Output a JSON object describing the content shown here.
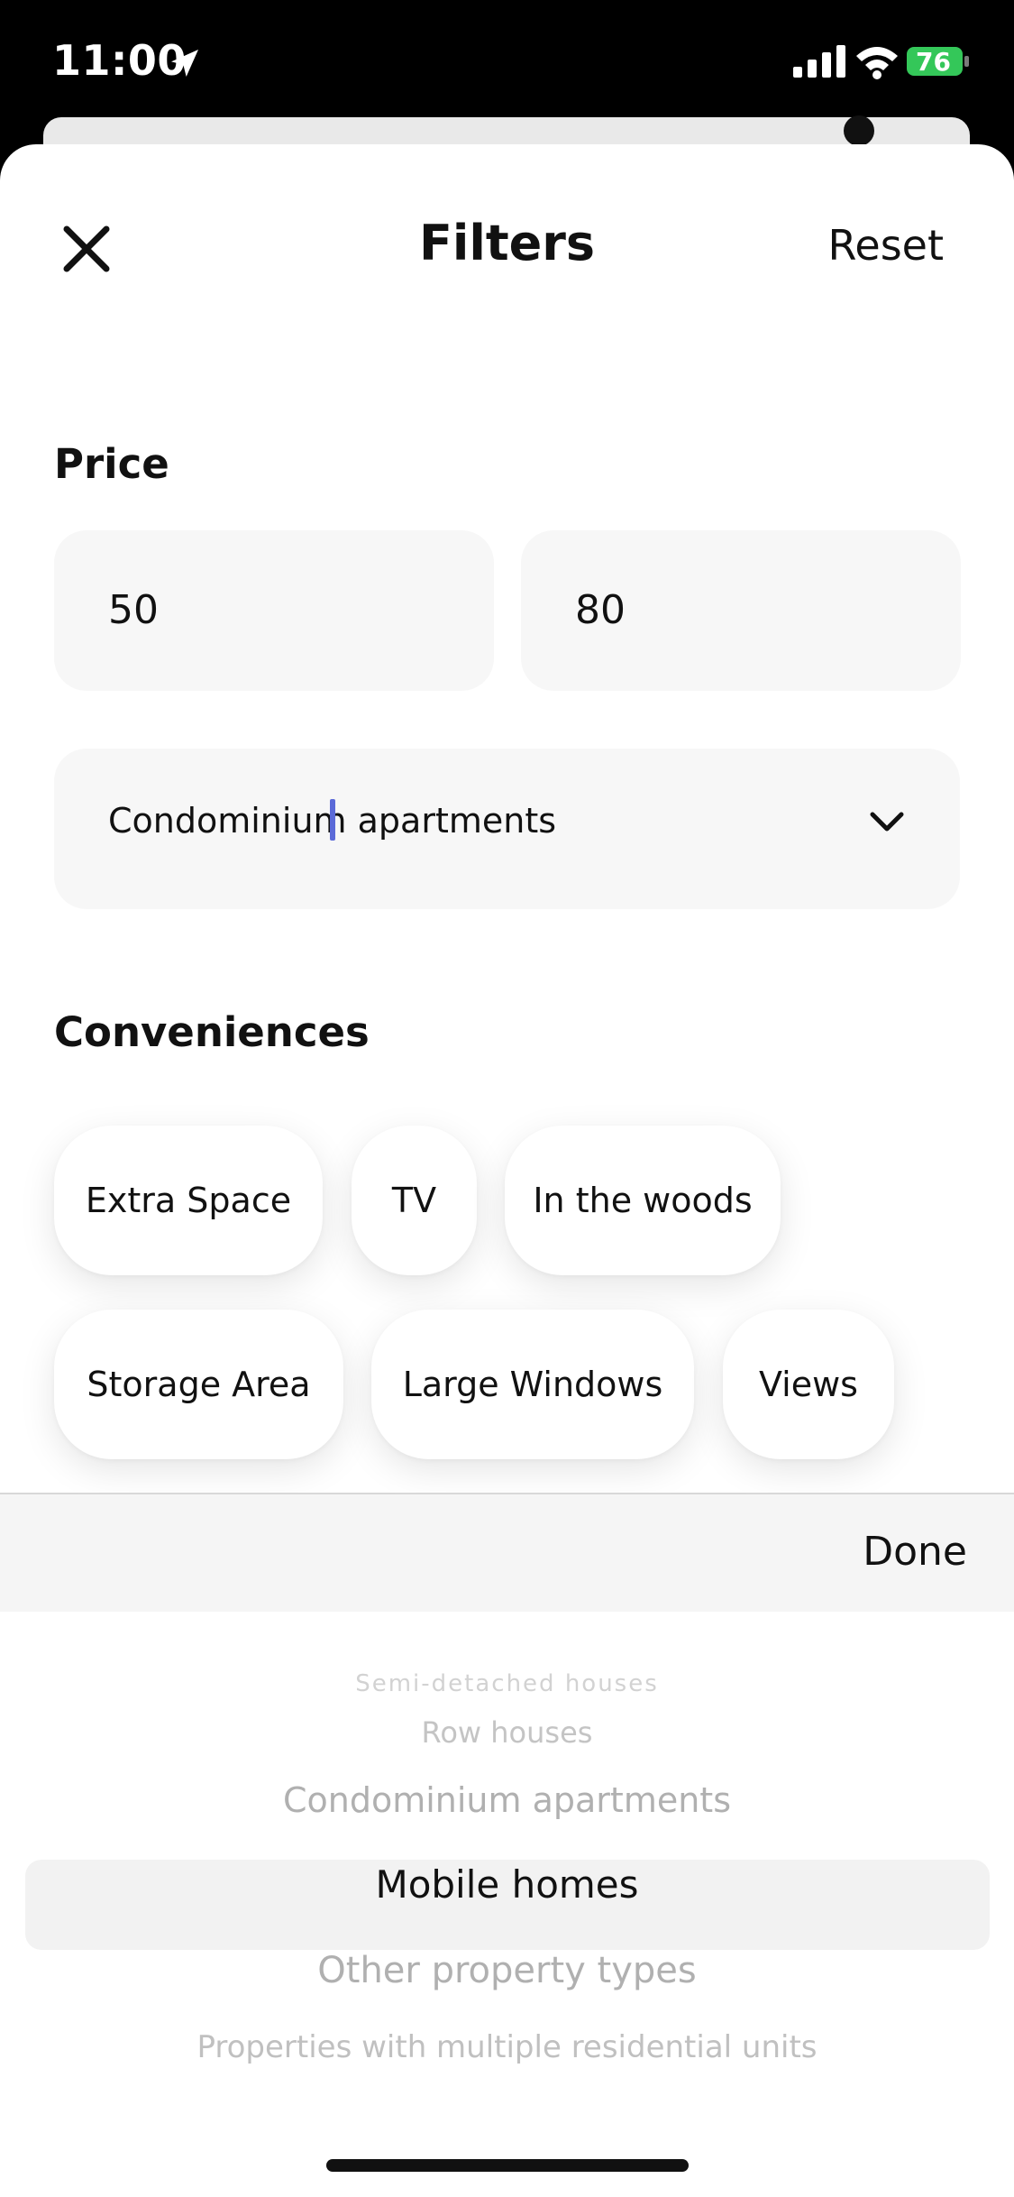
{
  "status_bar": {
    "time": "11:00",
    "battery": "76"
  },
  "header": {
    "title": "Filters",
    "reset_label": "Reset"
  },
  "price": {
    "title": "Price",
    "min_value": "50",
    "max_value": "80",
    "property_type": "Condominium apartments"
  },
  "conveniences": {
    "title": "Conveniences",
    "chips": [
      "Extra Space",
      "TV",
      "In the woods",
      "Storage Area",
      "Large Windows",
      "Views"
    ]
  },
  "toolbar": {
    "done_label": "Done"
  },
  "picker": {
    "items": [
      "Semi-detached houses",
      "Row houses",
      "Condominium apartments",
      "Mobile homes",
      "Other property types",
      "Properties with multiple residential units"
    ],
    "selected": "Mobile homes"
  },
  "colors": {
    "accent_caret": "#5b6ad8",
    "battery": "#34c759"
  }
}
